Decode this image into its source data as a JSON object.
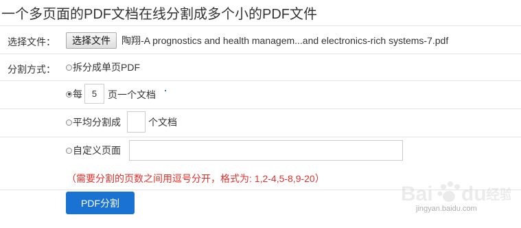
{
  "title": "一个多页面的PDF文档在线分割成多个小的PDF文件",
  "file_row": {
    "label": "选择文件：",
    "button_label": "选择文件",
    "file_name": "陶翔-A prognostics and health managem...and electronics-rich systems-7.pdf"
  },
  "split_mode": {
    "label": "分割方式：",
    "options": [
      {
        "label": "拆分成单页PDF",
        "checked": false
      },
      {
        "prefix": "每",
        "value": "5",
        "suffix": "页一个文档",
        "checked": true
      },
      {
        "prefix": "平均分割成",
        "value": "",
        "suffix": "个文档",
        "checked": false
      },
      {
        "prefix": "自定义页面",
        "value": "",
        "checked": false
      }
    ]
  },
  "hint": "（需要分割的页数之间用逗号分开，格式为: 1,2-4,5-8,9-20）",
  "submit_label": "PDF分割",
  "watermark": {
    "logo_text": "Baidu 经验",
    "url_text": "jingyan.baidu.com"
  },
  "colors": {
    "button_bg": "#1a73d3",
    "hint_text": "#e0312b"
  }
}
